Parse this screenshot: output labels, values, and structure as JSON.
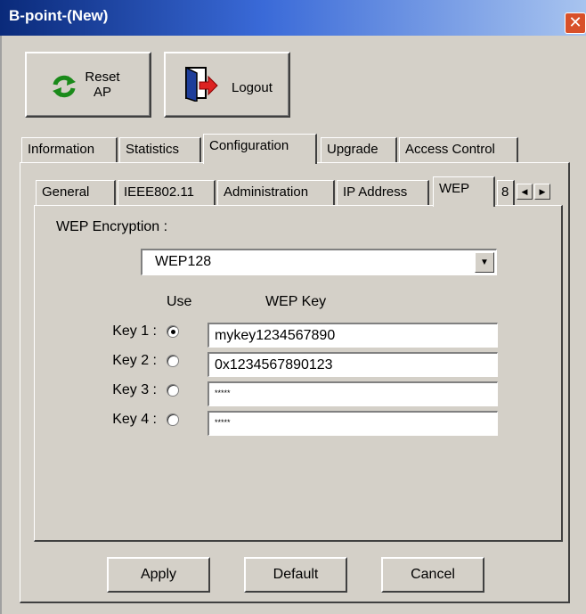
{
  "window": {
    "title": "B-point-(New)",
    "close_glyph": "✕"
  },
  "toolbar": {
    "reset_line1": "Reset",
    "reset_line2": "AP",
    "reset_icon": "refresh-icon",
    "logout_label": "Logout",
    "logout_icon": "door-exit-icon"
  },
  "main_tabs": [
    {
      "label": "Information",
      "active": false
    },
    {
      "label": "Statistics",
      "active": false
    },
    {
      "label": "Configuration",
      "active": true
    },
    {
      "label": "Upgrade",
      "active": false
    },
    {
      "label": "Access Control",
      "active": false
    }
  ],
  "sub_tabs": [
    {
      "label": "General",
      "active": false
    },
    {
      "label": "IEEE802.11",
      "active": false
    },
    {
      "label": "Administration",
      "active": false
    },
    {
      "label": "IP Address",
      "active": false
    },
    {
      "label": "WEP",
      "active": true
    },
    {
      "label": "8",
      "active": false
    }
  ],
  "wep": {
    "section_label": "WEP Encryption :",
    "encryption_value": "WEP128",
    "use_header": "Use",
    "key_header": "WEP Key",
    "keys": [
      {
        "label": "Key 1 :",
        "selected": true,
        "value": "mykey1234567890"
      },
      {
        "label": "Key 2 :",
        "selected": false,
        "value": "0x1234567890123"
      },
      {
        "label": "Key 3 :",
        "selected": false,
        "value": "*****"
      },
      {
        "label": "Key 4 :",
        "selected": false,
        "value": "*****"
      }
    ]
  },
  "actions": {
    "apply_label": "Apply",
    "default_label": "Default",
    "cancel_label": "Cancel"
  },
  "colors": {
    "titlebar_start": "#0a2a7a",
    "titlebar_end": "#a8c4ef",
    "dialog_face": "#d4d0c8",
    "close_button": "#d8502a"
  }
}
